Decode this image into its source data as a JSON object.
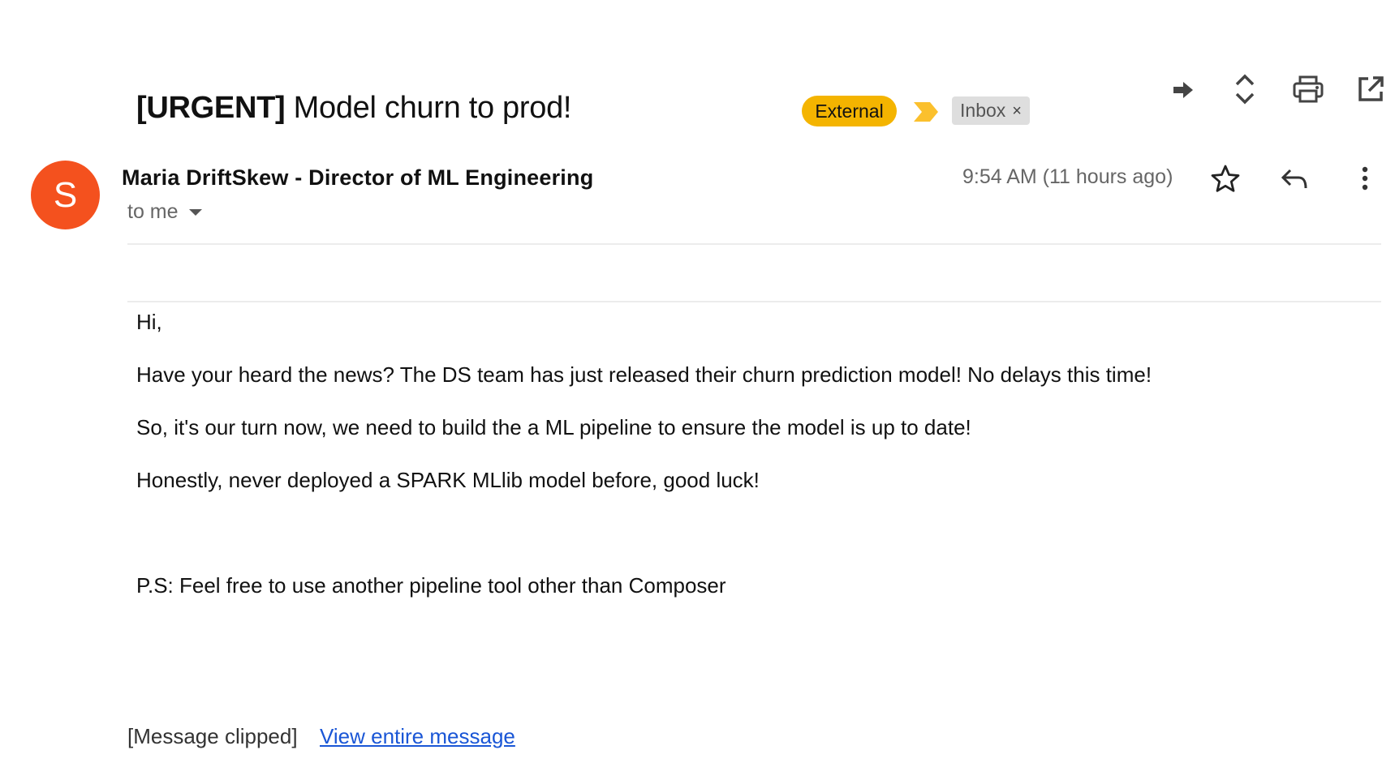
{
  "email": {
    "subject_prefix": "[URGENT]",
    "subject_text": "Model churn to prod!",
    "labels": {
      "external": "External",
      "inbox": "Inbox",
      "inbox_remove": "×"
    },
    "sender": "Maria DriftSkew - Director of ML Engineering",
    "avatar_letter": "S",
    "recipient": "to me",
    "timestamp": "9:54 AM (11 hours ago)",
    "body": [
      "Hi,",
      "Have your heard the news? The DS team has just released their churn prediction model! No delays this time!",
      "So, it's our turn now, we need to build the a ML pipeline to ensure the model is up to date!",
      "Honestly, never deployed a SPARK MLlib model before, good luck!",
      "P.S: Feel free to use another pipeline tool other than Composer"
    ],
    "clipped_text": "[Message clipped]",
    "view_entire_link": "View entire message"
  },
  "icons": {
    "top_actions": [
      "forward-arrow-icon",
      "expand-collapse-icon",
      "print-icon",
      "open-in-new-window-icon"
    ],
    "message_actions": [
      "star-icon",
      "reply-icon",
      "more-vert-icon"
    ],
    "importance": "importance-marker-icon",
    "recipient_dropdown": "dropdown-caret-icon"
  },
  "colors": {
    "avatar": "#f4511e",
    "external_label": "#f4b400",
    "importance_marker": "#fbc02d",
    "inbox_label": "#dedede",
    "link": "#1a56d6"
  }
}
